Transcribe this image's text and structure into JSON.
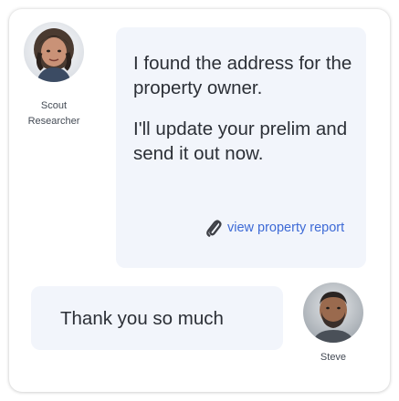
{
  "conversation": {
    "agent": {
      "name": "Scout",
      "role": "Researcher"
    },
    "user": {
      "name": "Steve"
    },
    "messages": [
      {
        "text": "I found the address for the property owner."
      },
      {
        "text": "I'll update your prelim and send it out now."
      },
      {
        "text": "Thank you so much"
      }
    ],
    "attachment": {
      "label": "view property report",
      "icon": "paperclip-icon"
    }
  },
  "colors": {
    "bubble": "#f2f5fb",
    "link": "#3d6ad6",
    "text": "#2b2f36"
  }
}
